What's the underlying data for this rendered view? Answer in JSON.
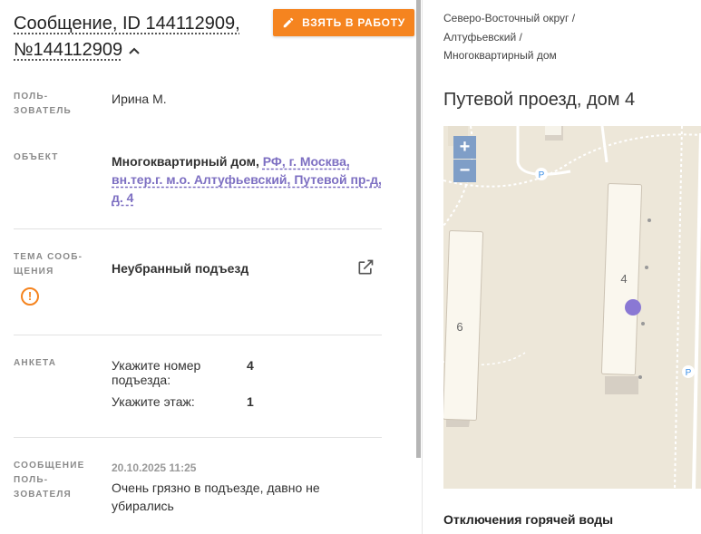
{
  "message": {
    "title": "Сообщение, ID 144112909, №144112909",
    "take_button": "ВЗЯТЬ В РАБОТУ"
  },
  "fields": {
    "user_label": "ПОЛЬ-\nЗОВАТЕЛЬ",
    "user_value": "Ирина М.",
    "object_label": "ОБЪЕКТ",
    "object_type": "Многоквартирный дом,",
    "object_address": "РФ, г. Москва, вн.тер.г. м.о. Алтуфьевский, Путевой пр-д, д. 4",
    "topic_label": "ТЕМА СООБ-\nЩЕНИЯ",
    "topic_value": "Неубранный подъезд",
    "survey_label": "АНКЕТА",
    "survey": [
      {
        "question": "Укажите номер подъезда:",
        "answer": "4"
      },
      {
        "question": "Укажите этаж:",
        "answer": "1"
      }
    ],
    "usermsg_label": "СООБЩЕНИЕ\nПОЛЬ-\nЗОВАТЕЛЯ",
    "usermsg_date": "20.10.2025 11:25",
    "usermsg_text": "Очень грязно в подъезде, давно не убирались"
  },
  "right": {
    "breadcrumb": [
      "Северо-Восточный округ /",
      "Алтуфьевский /",
      "Многоквартирный дом"
    ],
    "address_title": "Путевой проезд, дом 4",
    "map": {
      "zoom_in": "+",
      "zoom_out": "−",
      "building_labels": [
        "4",
        "6"
      ],
      "parking_label": "P",
      "marker_color": "#8a78d4"
    },
    "hot_water": "Отключения горячей воды"
  },
  "colors": {
    "accent": "#f5841f",
    "link": "#7d6fc2"
  }
}
